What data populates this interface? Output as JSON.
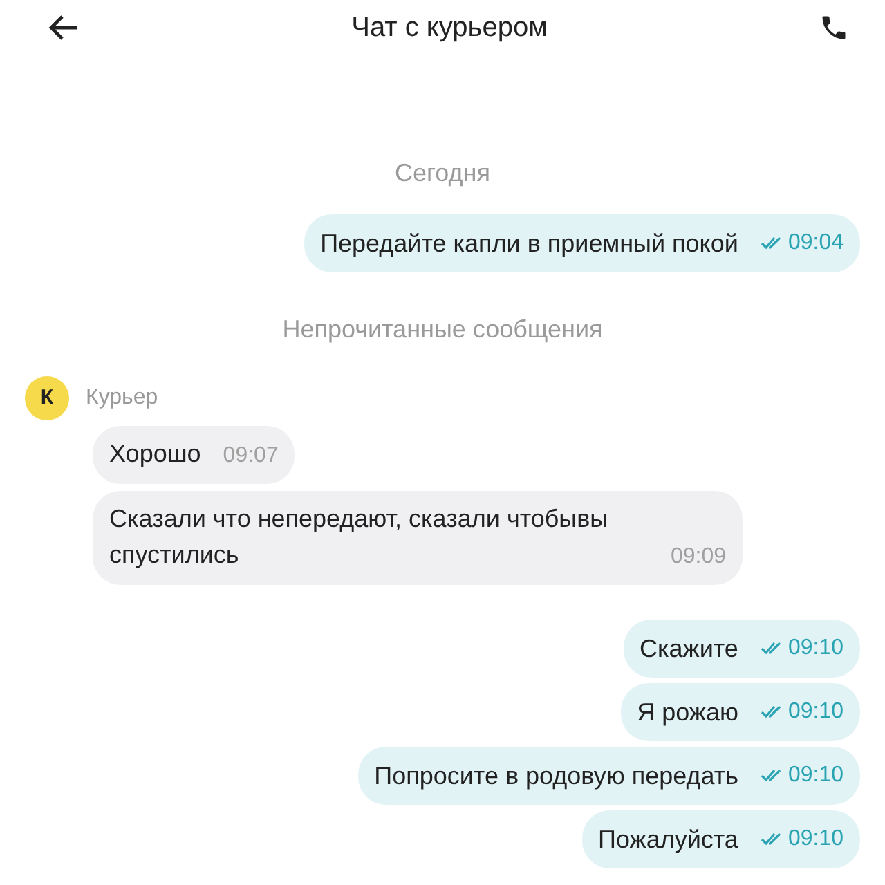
{
  "header": {
    "title": "Чат с курьером"
  },
  "messages": [
    {
      "kind": "date",
      "text": "Сегодня"
    },
    {
      "kind": "outgoing",
      "text": "Передайте капли в приемный покой",
      "time": "09:04",
      "read": true
    },
    {
      "kind": "notice",
      "text": "Непрочитанные сообщения"
    },
    {
      "kind": "sender",
      "avatar": "К",
      "text": "Курьер"
    },
    {
      "kind": "incoming",
      "text": "Хорошо",
      "time": "09:07"
    },
    {
      "kind": "incoming",
      "text": "Сказали что непередают, сказали чтобывы спустились",
      "time": "09:09"
    },
    {
      "kind": "outgoing",
      "text": "Скажите",
      "time": "09:10",
      "read": true
    },
    {
      "kind": "outgoing",
      "text": "Я рожаю",
      "time": "09:10",
      "read": true
    },
    {
      "kind": "outgoing",
      "text": "Попросите в родовую передать",
      "time": "09:10",
      "read": true
    },
    {
      "kind": "outgoing",
      "text": "Пожалуйста",
      "time": "09:10",
      "read": true
    }
  ]
}
